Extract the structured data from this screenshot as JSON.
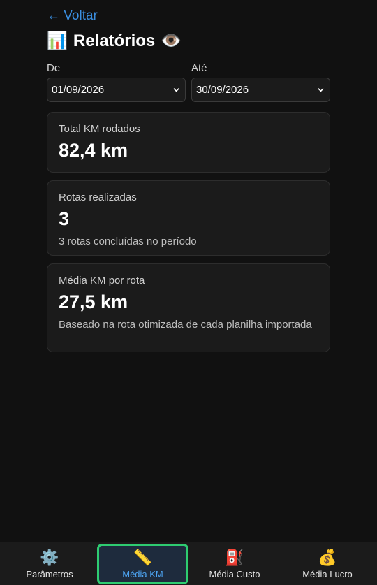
{
  "header": {
    "back_label": "← Voltar",
    "title": "Relatórios",
    "title_icon": "📊",
    "title_trail_icon": "👁️"
  },
  "filters": {
    "from_label": "De",
    "from_value": "01/09/2026",
    "to_label": "Até",
    "to_value": "30/09/2026"
  },
  "cards": [
    {
      "label": "Total KM rodados",
      "value": "82,4 km",
      "sub": ""
    },
    {
      "label": "Rotas realizadas",
      "value": "3",
      "sub": "3 rotas concluídas no período"
    },
    {
      "label": "Média KM por rota",
      "value": "27,5 km",
      "sub": "Baseado na rota otimizada de cada planilha importada"
    }
  ],
  "nav": {
    "items": [
      {
        "label": "Parâmetros",
        "icon": "⚙️",
        "active": false
      },
      {
        "label": "Média KM",
        "icon": "📏",
        "active": true
      },
      {
        "label": "Média Custo",
        "icon": "⛽",
        "active": false
      },
      {
        "label": "Média Lucro",
        "icon": "💰",
        "active": false
      }
    ]
  },
  "colors": {
    "background": "#111111",
    "card": "#1b1b1b",
    "link": "#3b8fe0",
    "active_border": "#2ecc71",
    "active_text": "#4da3f0"
  }
}
